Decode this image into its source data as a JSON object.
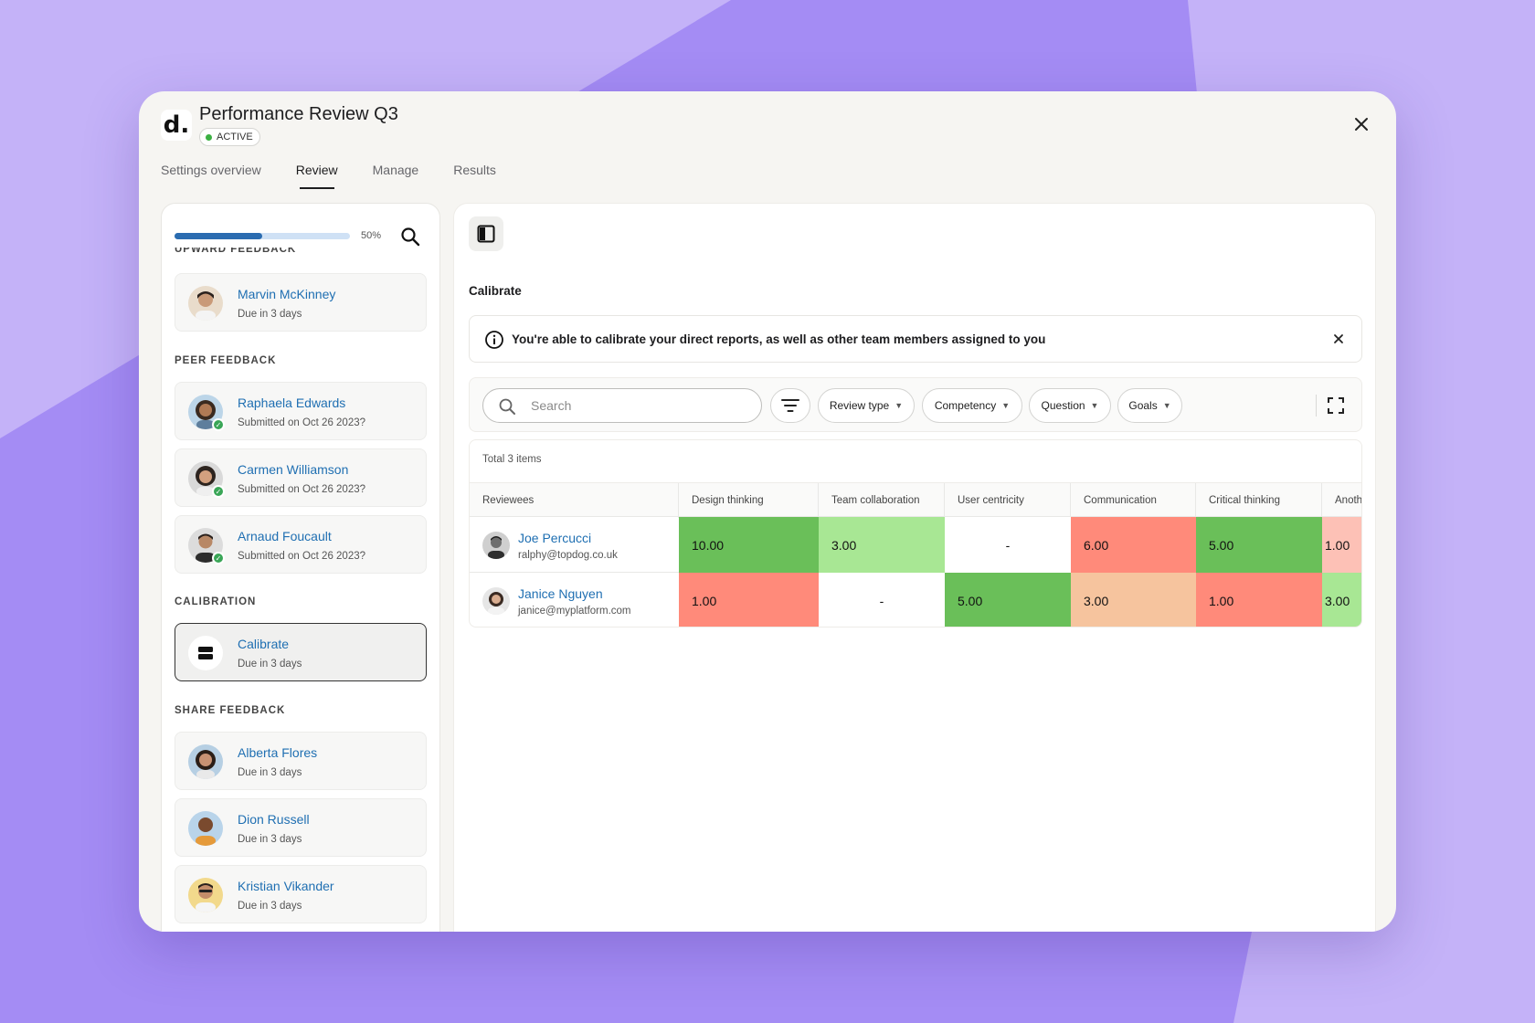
{
  "colors": {
    "background": "#a48cf4",
    "accent_link": "#1f6fb2",
    "progress": "#2b6cb0",
    "score_dark_green": "#6abf59",
    "score_light_green": "#a8e794",
    "score_red": "#ff8a7a",
    "score_peach": "#f6c49e",
    "score_pink": "#fdc1b6"
  },
  "header": {
    "logo": "d.",
    "title": "Performance Review Q3",
    "status_badge": "ACTIVE",
    "close_icon": "close-icon"
  },
  "tabs": [
    {
      "label": "Settings overview",
      "active": false
    },
    {
      "label": "Review",
      "active": true
    },
    {
      "label": "Manage",
      "active": false
    },
    {
      "label": "Results",
      "active": false
    }
  ],
  "sidebar": {
    "progress": {
      "value": 0.5,
      "label": "50%"
    },
    "sections": [
      {
        "label": "UPWARD FEEDBACK",
        "items": [
          {
            "name": "Marvin McKinney",
            "sub": "Due in 3 days",
            "submitted": false
          }
        ]
      },
      {
        "label": "PEER FEEDBACK",
        "items": [
          {
            "name": "Raphaela Edwards",
            "sub": "Submitted on Oct 26 2023?",
            "submitted": true
          },
          {
            "name": "Carmen Williamson",
            "sub": "Submitted on Oct 26 2023?",
            "submitted": true
          },
          {
            "name": "Arnaud Foucault",
            "sub": "Submitted on Oct 26 2023?",
            "submitted": true
          }
        ]
      },
      {
        "label": "CALIBRATION",
        "items": [
          {
            "name": "Calibrate",
            "sub": "Due in 3 days",
            "selected": true
          }
        ]
      },
      {
        "label": "SHARE FEEDBACK",
        "items": [
          {
            "name": "Alberta Flores",
            "sub": "Due in 3 days",
            "submitted": false
          },
          {
            "name": "Dion Russell",
            "sub": "Due in 3 days",
            "submitted": false
          },
          {
            "name": "Kristian Vikander",
            "sub": "Due in 3 days",
            "submitted": false
          }
        ]
      }
    ]
  },
  "main": {
    "section_title": "Calibrate",
    "info_message": "You're able to calibrate your direct reports, as well as other team members assigned to you",
    "search_placeholder": "Search",
    "filters": [
      "Review type",
      "Competency",
      "Question",
      "Goals"
    ],
    "table": {
      "total_label": "Total 3 items",
      "columns": [
        "Reviewees",
        "Design thinking",
        "Team collaboration",
        "User centricity",
        "Communication",
        "Critical thinking",
        "Anoth"
      ],
      "rows": [
        {
          "name": "Joe Percucci",
          "email": "ralphy@topdog.co.uk",
          "scores": [
            "10.00",
            "3.00",
            "-",
            "6.00",
            "5.00",
            "1.00"
          ]
        },
        {
          "name": "Janice Nguyen",
          "email": "janice@myplatform.com",
          "scores": [
            "1.00",
            "-",
            "5.00",
            "3.00",
            "1.00",
            "3.00"
          ]
        }
      ]
    }
  }
}
